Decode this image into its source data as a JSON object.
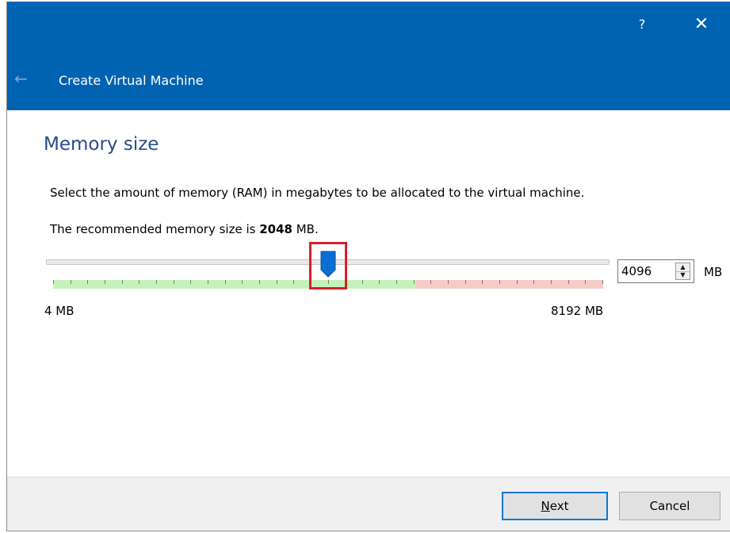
{
  "window": {
    "title": "Create Virtual Machine",
    "help_label": "?",
    "close_label": "✕",
    "back_label": "←"
  },
  "page": {
    "heading": "Memory size",
    "description": "Select the amount of memory (RAM) in megabytes to be allocated to the virtual machine.",
    "recommended_prefix": "The recommended memory size is ",
    "recommended_value": "2048",
    "recommended_suffix": " MB."
  },
  "memory_slider": {
    "min": 4,
    "max": 8192,
    "value": 4096,
    "value_fraction": 0.5,
    "green_fraction": 0.66,
    "min_label": "4 MB",
    "max_label": "8192 MB",
    "colors": {
      "safe": "#c5f2bb",
      "warning": "#f6cbc5",
      "thumb": "#0a6fd1",
      "highlight": "#d3222a"
    }
  },
  "memory_spinbox": {
    "value": "4096",
    "unit": "MB"
  },
  "buttons": {
    "next_accel": "N",
    "next_rest": "ext",
    "cancel": "Cancel"
  },
  "colors": {
    "header": "#0063b1",
    "heading_text": "#2a4a8c",
    "footer": "#f0f0f0",
    "focus_border": "#0078d7"
  }
}
